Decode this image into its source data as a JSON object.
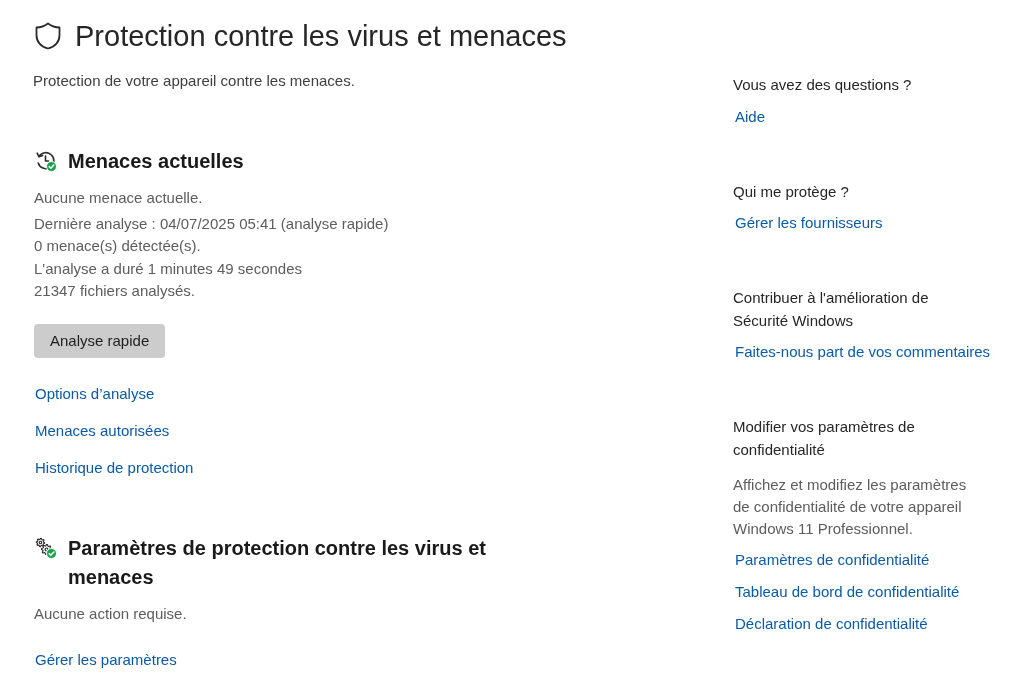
{
  "header": {
    "title": "Protection contre les virus et menaces",
    "subtitle": "Protection de votre appareil contre les menaces."
  },
  "sections": [
    {
      "kind": "scan",
      "heading": "Menaces actuelles",
      "status": "Aucune menace actuelle.",
      "details": [
        "Dernière analyse : 04/07/2025 05:41 (analyse rapide)",
        "0 menace(s) détectée(s).",
        "L'analyse a duré 1 minutes 49 secondes",
        "21347 fichiers analysés."
      ],
      "button": "Analyse rapide",
      "links": [
        "Options d’analyse",
        "Menaces autorisées",
        "Historique de protection"
      ]
    },
    {
      "kind": "settings",
      "heading": "Paramètres de protection contre les virus et menaces",
      "status": "Aucune action requise.",
      "links": [
        "Gérer les paramètres"
      ]
    }
  ],
  "sidebar": [
    {
      "heading": "Vous avez des questions ?",
      "links": [
        "Aide"
      ]
    },
    {
      "heading": "Qui me protège ?",
      "links": [
        "Gérer les fournisseurs"
      ]
    },
    {
      "heading": "Contribuer à l'amélioration de Sécurité Windows",
      "links": [
        "Faites-nous part de vos commentaires"
      ]
    },
    {
      "heading": "Modifier vos paramètres de confidentialité",
      "description": "Affichez et modifiez les paramètres de confidentialité de votre appareil Windows 11 Professionnel.",
      "links": [
        "Paramètres de confidentialité",
        "Tableau de bord de confidentialité",
        "Déclaration de confidentialité"
      ]
    }
  ]
}
